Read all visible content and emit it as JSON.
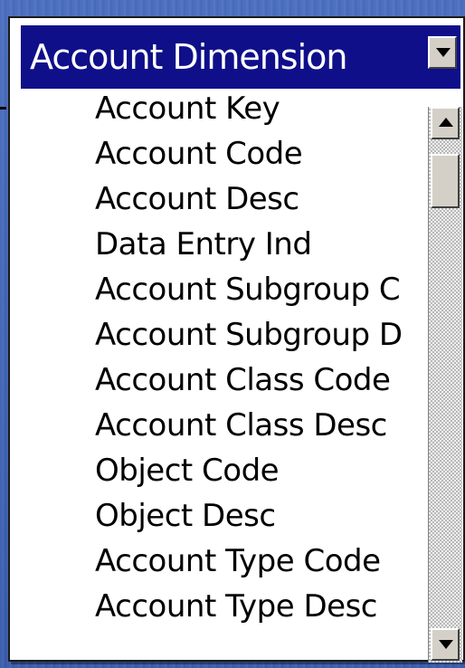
{
  "dropdown": {
    "title": "Account Dimension",
    "selected_index": 0,
    "items": [
      "Account Key",
      "Account Code",
      "Account Desc",
      "Data Entry Ind",
      "Account Subgroup C",
      "Account Subgroup D",
      "Account Class Code",
      "Account Class Desc",
      "Object Code",
      "Object Desc",
      "Account Type Code",
      "Account Type Desc"
    ]
  },
  "icons": {
    "header_button": "chevron-down-icon",
    "scroll_up": "scroll-up-arrow-icon",
    "scroll_down": "scroll-down-arrow-icon"
  },
  "colors": {
    "header_bg": "#0f0f8a",
    "header_text": "#ffffff",
    "background": "#4669bd",
    "list_bg": "#ffffff"
  }
}
